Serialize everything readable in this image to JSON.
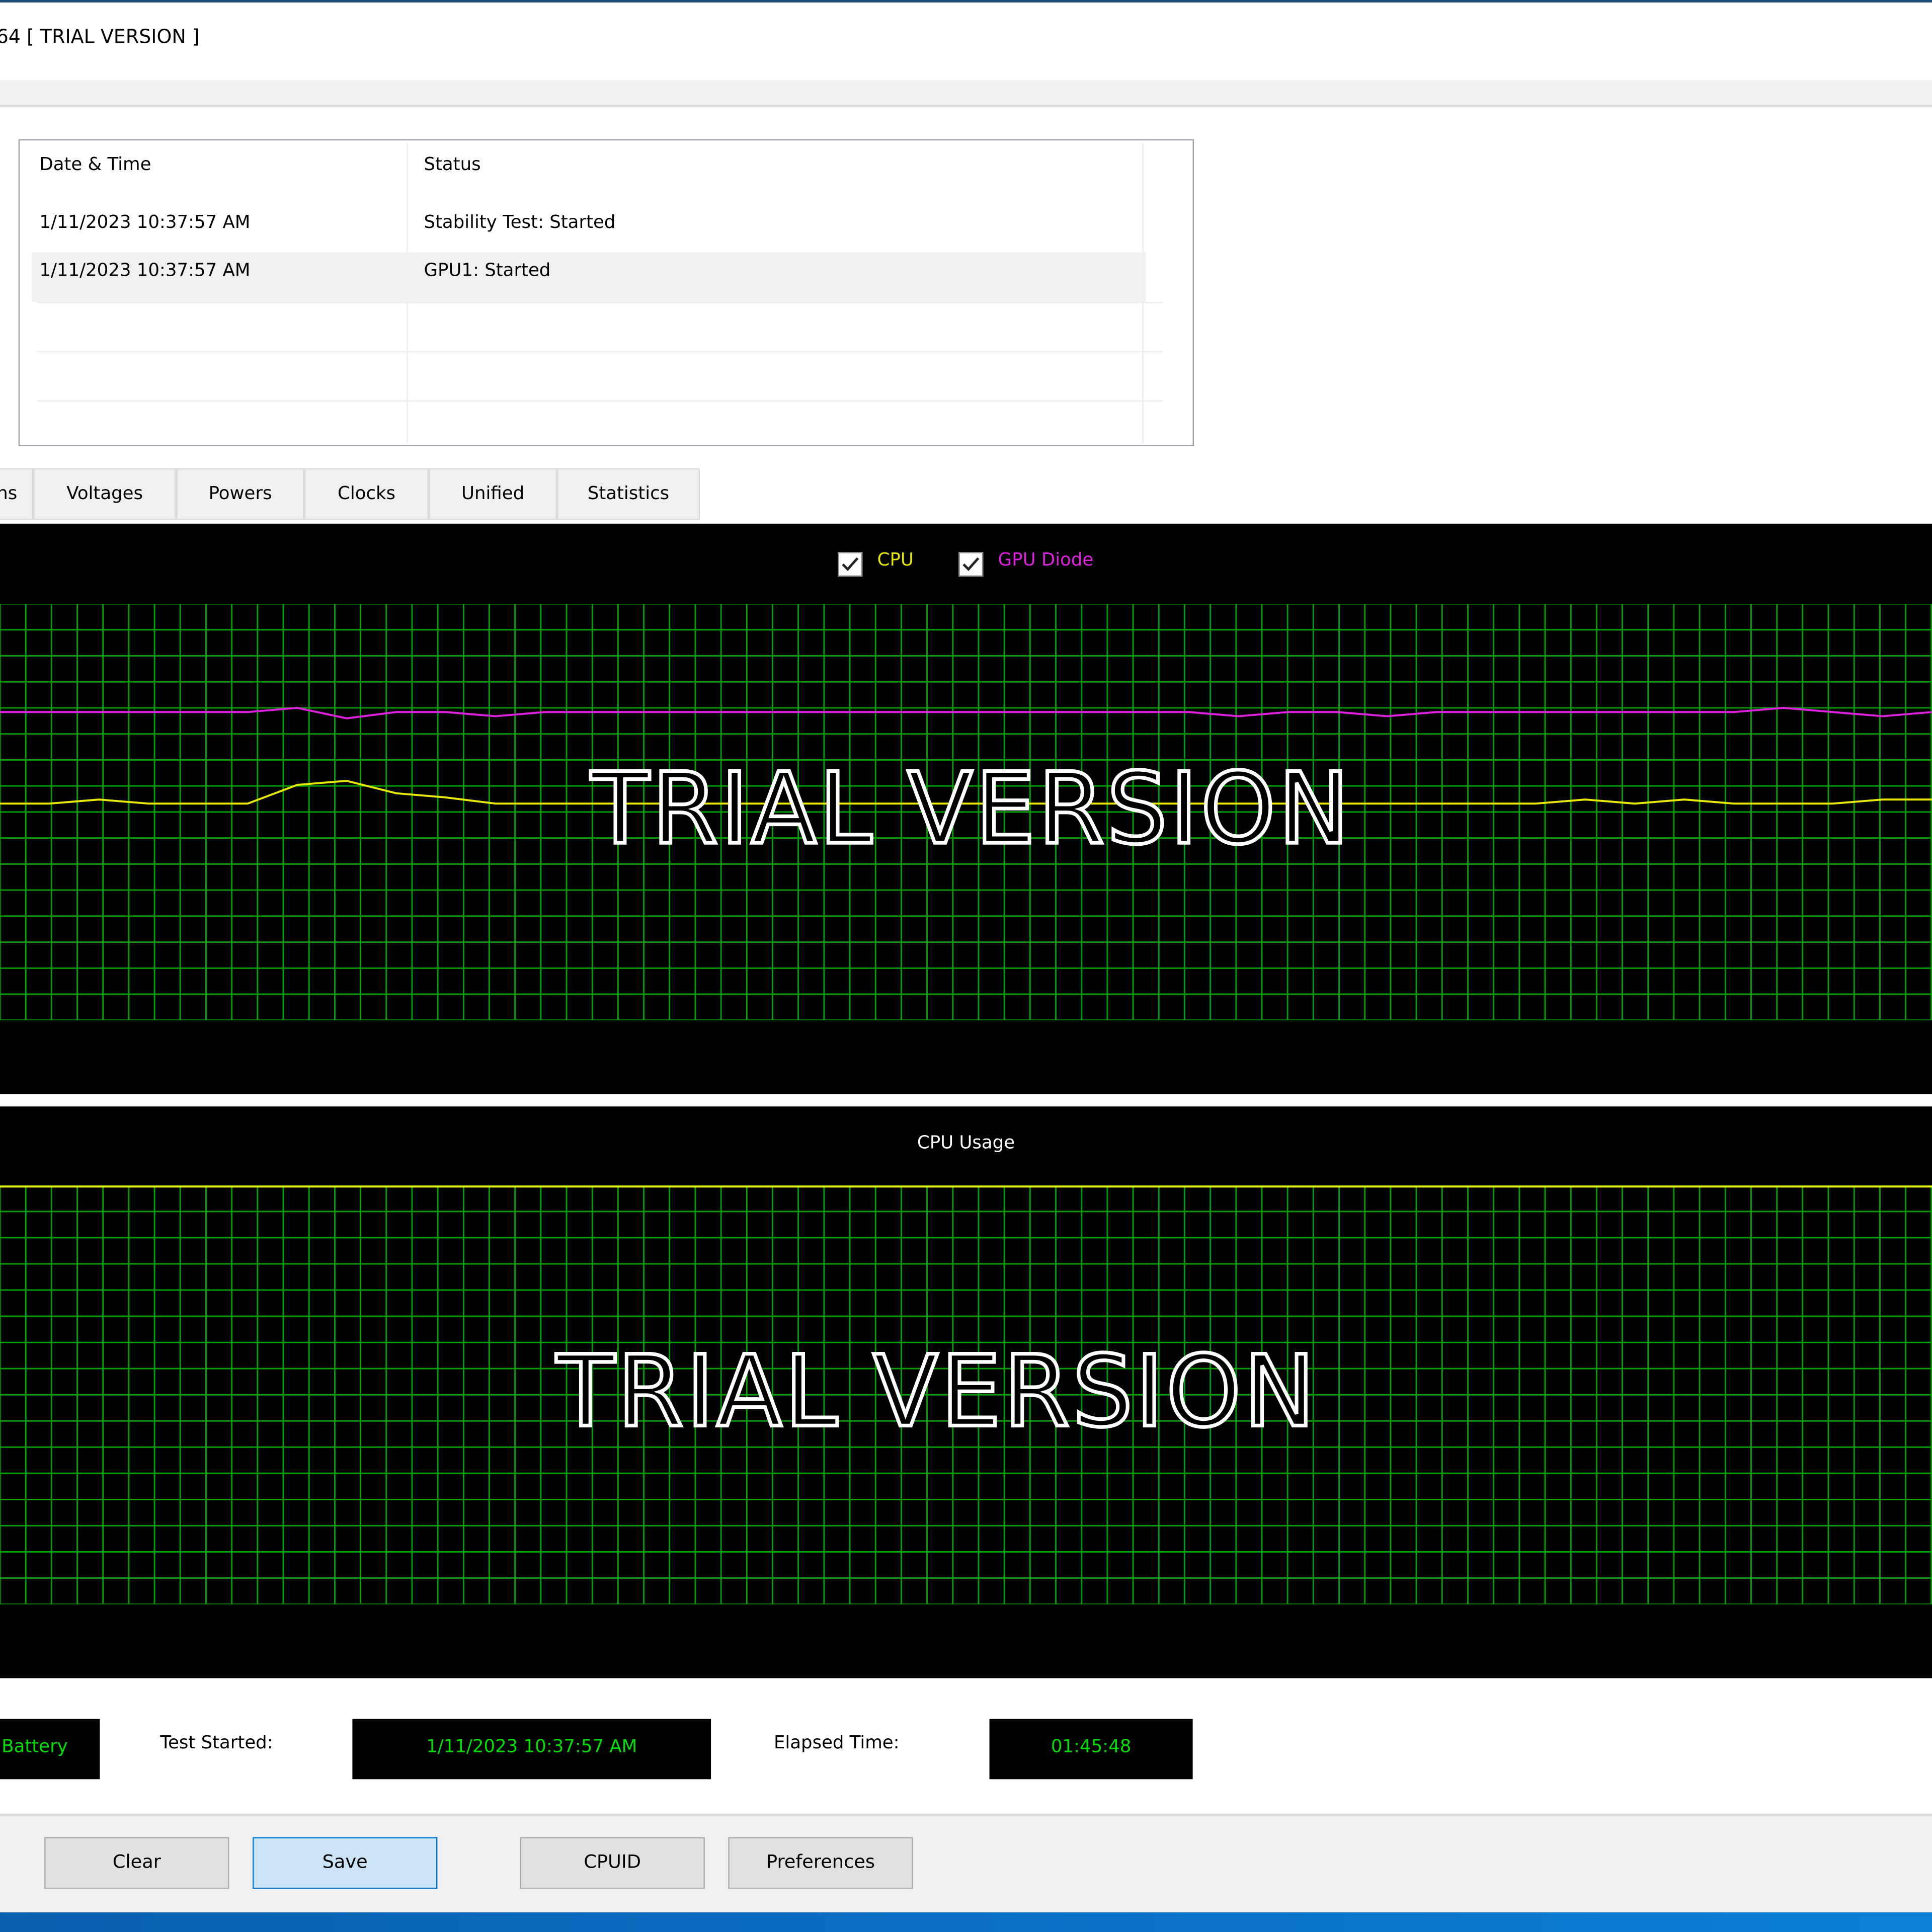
{
  "window": {
    "title": "64  [ TRIAL VERSION ]"
  },
  "log": {
    "columns": [
      "Date & Time",
      "Status"
    ],
    "rows": [
      {
        "datetime": "1/11/2023 10:37:57 AM",
        "status": "Stability Test: Started"
      },
      {
        "datetime": "1/11/2023 10:37:57 AM",
        "status": "GPU1: Started",
        "selected": true
      }
    ]
  },
  "tabs": [
    {
      "label": "Fans"
    },
    {
      "label": "Voltages"
    },
    {
      "label": "Powers"
    },
    {
      "label": "Clocks"
    },
    {
      "label": "Unified"
    },
    {
      "label": "Statistics"
    }
  ],
  "watermark": "TRIAL VERSION",
  "colors": {
    "grid": "#00a000",
    "cpu": "#e8e800",
    "gpu_diode": "#e020e0",
    "usage": "#e8e800",
    "readout": "#00e000",
    "accent": "#0078d7"
  },
  "chart_data": [
    {
      "type": "line",
      "title": "",
      "legend": "top-center",
      "grid": true,
      "ylim": [
        0,
        100
      ],
      "series": [
        {
          "name": "CPU",
          "checked": true,
          "color": "#e8e800",
          "values": [
            52,
            52,
            53,
            52,
            52,
            52,
            56.5,
            57.5,
            54.5,
            53.5,
            52,
            52,
            52,
            52,
            52,
            52,
            52,
            52,
            52,
            52,
            52,
            52,
            52,
            52,
            52,
            52,
            52,
            52,
            52,
            52,
            52,
            52,
            53,
            52,
            53,
            52,
            52,
            52,
            53,
            53
          ]
        },
        {
          "name": "GPU Diode",
          "checked": true,
          "color": "#e020e0",
          "values": [
            74,
            74,
            74,
            74,
            74,
            74,
            75,
            72.5,
            74,
            74,
            73,
            74,
            74,
            74,
            74,
            74,
            74,
            74,
            74,
            74,
            74,
            74,
            74,
            74,
            74,
            73,
            74,
            74,
            73,
            74,
            74,
            74,
            74,
            74,
            74,
            74,
            75,
            74,
            73,
            74
          ]
        }
      ]
    },
    {
      "type": "line",
      "title": "CPU Usage",
      "grid": true,
      "ylim": [
        0,
        100
      ],
      "series": [
        {
          "color": "#e8e800",
          "values": [
            100,
            100,
            100,
            100,
            100,
            100,
            100,
            100,
            100,
            100,
            100,
            100,
            100,
            100,
            100,
            100,
            100,
            100,
            100,
            100,
            100,
            100,
            100,
            100,
            100,
            100,
            100,
            100,
            100,
            100,
            100,
            100,
            100,
            100,
            100,
            100,
            100,
            100,
            100,
            100
          ]
        }
      ]
    }
  ],
  "status": {
    "battery_value": "Battery",
    "test_started_label": "Test Started:",
    "test_started_value": "1/11/2023 10:37:57 AM",
    "elapsed_label": "Elapsed Time:",
    "elapsed_value": "01:45:48"
  },
  "buttons": {
    "clear": "Clear",
    "save": "Save",
    "cpuid": "CPUID",
    "preferences": "Preferences"
  }
}
